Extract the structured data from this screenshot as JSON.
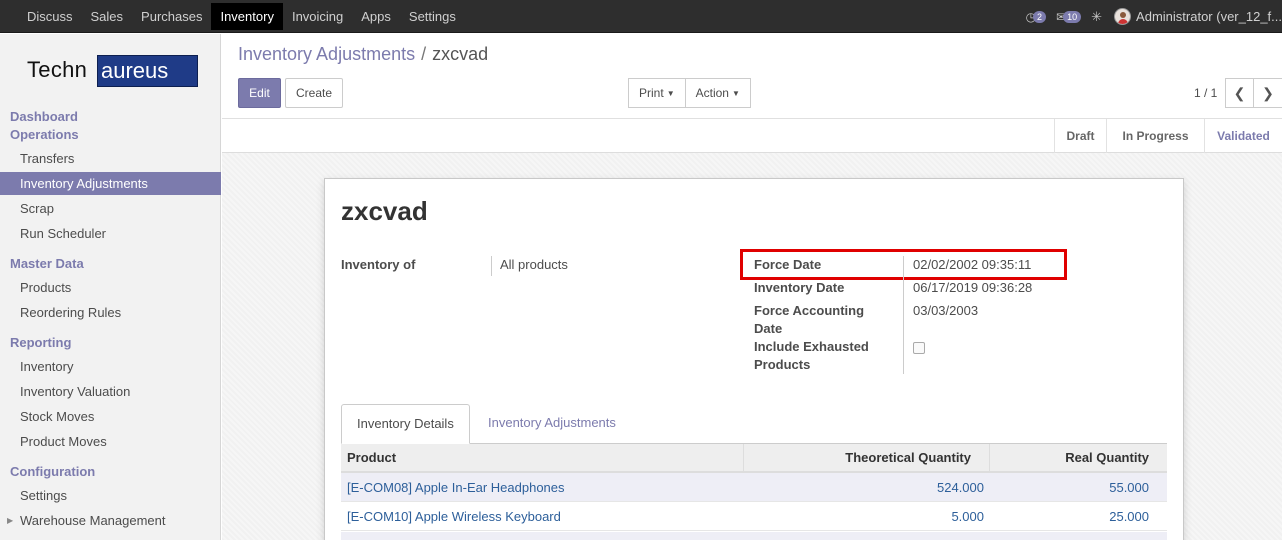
{
  "topbar": {
    "menu": [
      "Discuss",
      "Sales",
      "Purchases",
      "Inventory",
      "Invoicing",
      "Apps",
      "Settings"
    ],
    "active_menu": "Inventory",
    "conversation_count": "2",
    "message_count": "10",
    "user": "Administrator (ver_12_f..."
  },
  "sidebar": {
    "logo_left": "Techn",
    "logo_right": "aureus",
    "sections": {
      "dashboard": "Dashboard",
      "operations": "Operations",
      "master_data": "Master Data",
      "reporting": "Reporting",
      "configuration": "Configuration"
    },
    "items": {
      "transfers": "Transfers",
      "inventory_adjustments": "Inventory Adjustments",
      "scrap": "Scrap",
      "run_scheduler": "Run Scheduler",
      "products": "Products",
      "reordering_rules": "Reordering Rules",
      "inventory": "Inventory",
      "inventory_valuation": "Inventory Valuation",
      "stock_moves": "Stock Moves",
      "product_moves": "Product Moves",
      "settings": "Settings",
      "warehouse_management": "Warehouse Management"
    }
  },
  "breadcrumb": {
    "parent": "Inventory Adjustments",
    "separator": "/",
    "current": "zxcvad"
  },
  "buttons": {
    "edit": "Edit",
    "create": "Create",
    "print": "Print",
    "action": "Action"
  },
  "pager": {
    "text": "1 / 1"
  },
  "statusbar": {
    "stages": [
      "Draft",
      "In Progress",
      "Validated"
    ],
    "current": "Validated"
  },
  "record": {
    "title": "zxcvad",
    "inventory_of_label": "Inventory of",
    "inventory_of_value": "All products",
    "force_date_label": "Force Date",
    "force_date_value": "02/02/2002 09:35:11",
    "inventory_date_label": "Inventory Date",
    "inventory_date_value": "06/17/2019 09:36:28",
    "force_accounting_label_1": "Force Accounting",
    "force_accounting_label_2": "Date",
    "force_accounting_value": "03/03/2003",
    "include_exhausted_label_1": "Include Exhausted",
    "include_exhausted_label_2": "Products",
    "include_exhausted_checked": false
  },
  "tabs": {
    "details": "Inventory Details",
    "adjustments": "Inventory Adjustments"
  },
  "table": {
    "headers": {
      "product": "Product",
      "theoretical": "Theoretical Quantity",
      "real": "Real Quantity"
    },
    "rows": [
      {
        "product": "[E-COM08] Apple In-Ear Headphones",
        "theoretical": "524.000",
        "real": "55.000"
      },
      {
        "product": "[E-COM10] Apple Wireless Keyboard",
        "theoretical": "5.000",
        "real": "25.000"
      }
    ]
  }
}
